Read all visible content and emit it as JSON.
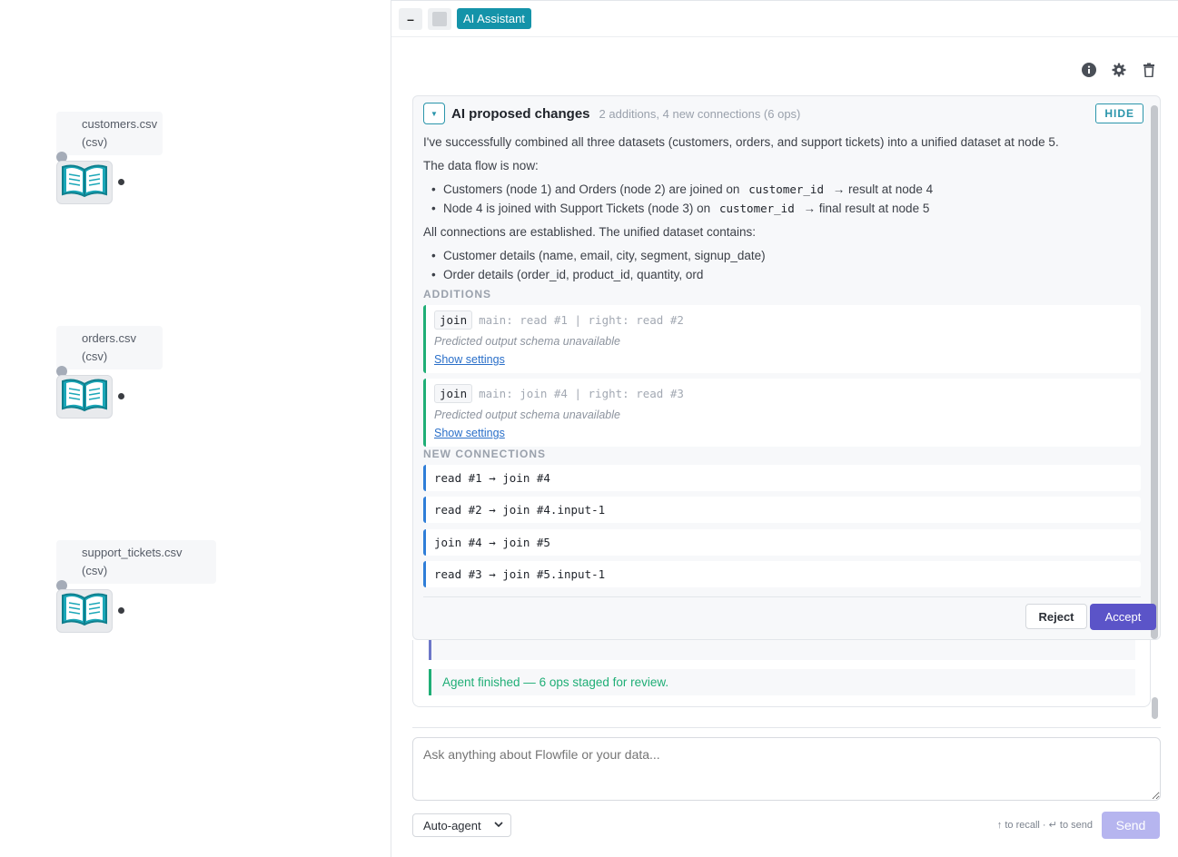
{
  "canvas": {
    "nodes": [
      {
        "name": "customers.csv",
        "type": "(csv)",
        "icon": "open-book-icon"
      },
      {
        "name": "orders.csv",
        "type": "(csv)",
        "icon": "open-book-icon"
      },
      {
        "name": "support_tickets.csv",
        "type": "(csv)",
        "icon": "open-book-icon"
      }
    ]
  },
  "panel": {
    "minimize_label": "–",
    "title": "AI Assistant",
    "tools": [
      "info-icon",
      "gear-icon",
      "trash-icon"
    ]
  },
  "changes": {
    "title": "AI proposed changes",
    "summary": "2 additions, 4 new connections (6 ops)",
    "hide_label": "HIDE",
    "message": {
      "intro": "I've successfully combined all three datasets (customers, orders, and support tickets) into a unified dataset at node 5.",
      "flow_heading": "The data flow is now:",
      "flow_1_a": "Customers (node 1) and Orders (node 2) are joined on",
      "flow_1_code": "customer_id",
      "flow_1_b": "→ result at node 4",
      "flow_2_a": "Node 4 is joined with Support Tickets (node 3) on",
      "flow_2_code": "customer_id",
      "flow_2_b": "→ final result at node 5",
      "contains_heading": "All connections are established. The unified dataset contains:",
      "contains_1": "Customer details (name, email, city, segment, signup_date)",
      "contains_2": "Order details (order_id, product_id, quantity, ord"
    },
    "additions_label": "ADDITIONS",
    "additions": [
      {
        "kind": "join",
        "detail": "main: read #1 | right: read #2",
        "schema": "Predicted output schema unavailable",
        "link": "Show settings"
      },
      {
        "kind": "join",
        "detail": "main: join #4 | right: read #3",
        "schema": "Predicted output schema unavailable",
        "link": "Show settings"
      }
    ],
    "connections_label": "NEW CONNECTIONS",
    "connections": [
      "read #1 → join #4",
      "read #2 → join #4.input-1",
      "join #4 → join #5",
      "read #3 → join #5.input-1"
    ],
    "reject_label": "Reject",
    "accept_label": "Accept"
  },
  "history": {
    "finished": "Agent finished — 6 ops staged for review."
  },
  "composer": {
    "placeholder": "Ask anything about Flowfile or your data...",
    "mode": "Auto-agent",
    "hint": "↑ to recall · ↵ to send",
    "send_label": "Send"
  },
  "colors": {
    "accent": "#1493a9",
    "accept": "#5b54c8",
    "addition": "#1fae76",
    "connection": "#2f7ed8"
  }
}
